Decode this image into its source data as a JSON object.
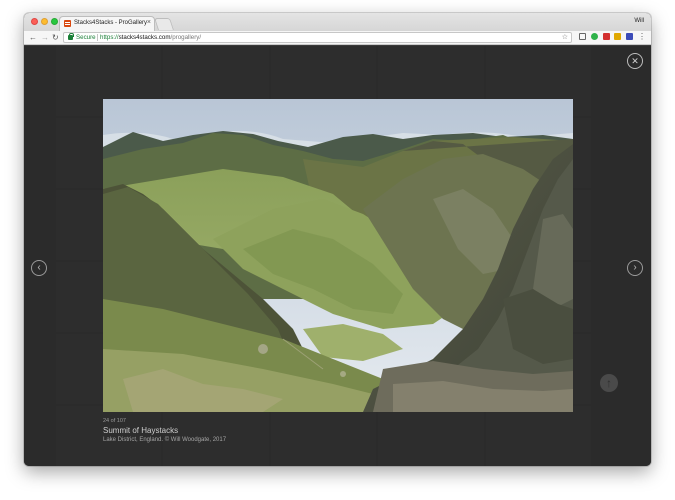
{
  "browser": {
    "tab_title": "Stacks4Stacks - ProGallery",
    "tab_close": "×",
    "profile_name": "Will",
    "secure_label": "Secure",
    "url_protocol": "https://",
    "url_host": "stacks4stacks.com",
    "url_path": "/progallery/",
    "nav_back": "←",
    "nav_forward": "→",
    "nav_reload": "↻",
    "bookmark_star": "☆",
    "menu": "⋮"
  },
  "lightbox": {
    "close_label": "✕",
    "prev_label": "‹",
    "next_label": "›",
    "scroll_top_label": "↑",
    "index_text": "24 of 107",
    "title": "Summit of Haystacks",
    "credit": "Lake District, England. © Will Woodgate, 2017"
  },
  "colors": {
    "secure_green": "#1a7f37",
    "lightbox_bg": "#2f2f2f",
    "brand_favicon": "#d9480f"
  },
  "icons": [
    "close-icon",
    "chevron-left-icon",
    "chevron-right-icon",
    "arrow-up-icon",
    "lock-icon",
    "star-icon",
    "cast-icon",
    "menu-icon"
  ]
}
